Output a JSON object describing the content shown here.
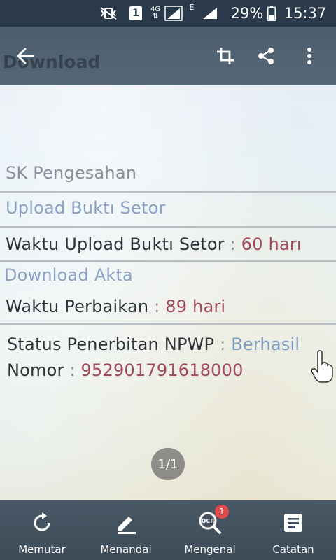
{
  "status_bar": {
    "sim": "1",
    "network": "4G",
    "data_type": "E",
    "battery": "29%",
    "time": "15:37"
  },
  "app_bar": {
    "ghost_title": "Download",
    "icons": [
      "back-arrow-icon",
      "crop-icon",
      "share-icon",
      "more-vert-icon"
    ]
  },
  "document": {
    "sk_pengesahan": "SK Pengesahan",
    "upload_bukti_setor": "Upload Buktı Setor",
    "waktu_upload_label": "Waktu Upload Buktı Setor",
    "waktu_upload_sep": " : ",
    "waktu_upload_value": "60 harı",
    "download_akta": "Download Akta",
    "waktu_perbaikan_label": "Waktu Perbaikan",
    "waktu_perbaikan_sep": " : ",
    "waktu_perbaikan_value": "89 hari",
    "status_npwp_label": "Status Penerbitan NPWP",
    "status_npwp_sep": " : ",
    "status_npwp_value": "Berhasil",
    "nomor_label": "Nomor",
    "nomor_sep": " : ",
    "nomor_value": "952901791618000"
  },
  "page_indicator": "1/1",
  "toolbar": {
    "rotate": "Memutar",
    "mark": "Menandai",
    "ocr": "Mengenal",
    "ocr_badge": "1",
    "notes": "Catatan"
  }
}
